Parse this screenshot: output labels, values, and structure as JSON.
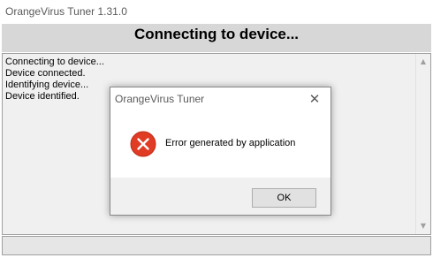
{
  "window": {
    "title": "OrangeVirus Tuner 1.31.0"
  },
  "banner": {
    "text": "Connecting to device..."
  },
  "log": {
    "lines": [
      "Connecting to device...",
      "Device connected.",
      "Identifying device...",
      "Device identified."
    ]
  },
  "dialog": {
    "title": "OrangeVirus Tuner",
    "close_glyph": "✕",
    "message": "Error generated by application",
    "ok_label": "OK",
    "icon": "error-icon"
  },
  "scrollbar": {
    "up_glyph": "▲",
    "down_glyph": "▼"
  },
  "colors": {
    "error_red": "#e03b24",
    "banner_bg": "#d7d7d7"
  }
}
